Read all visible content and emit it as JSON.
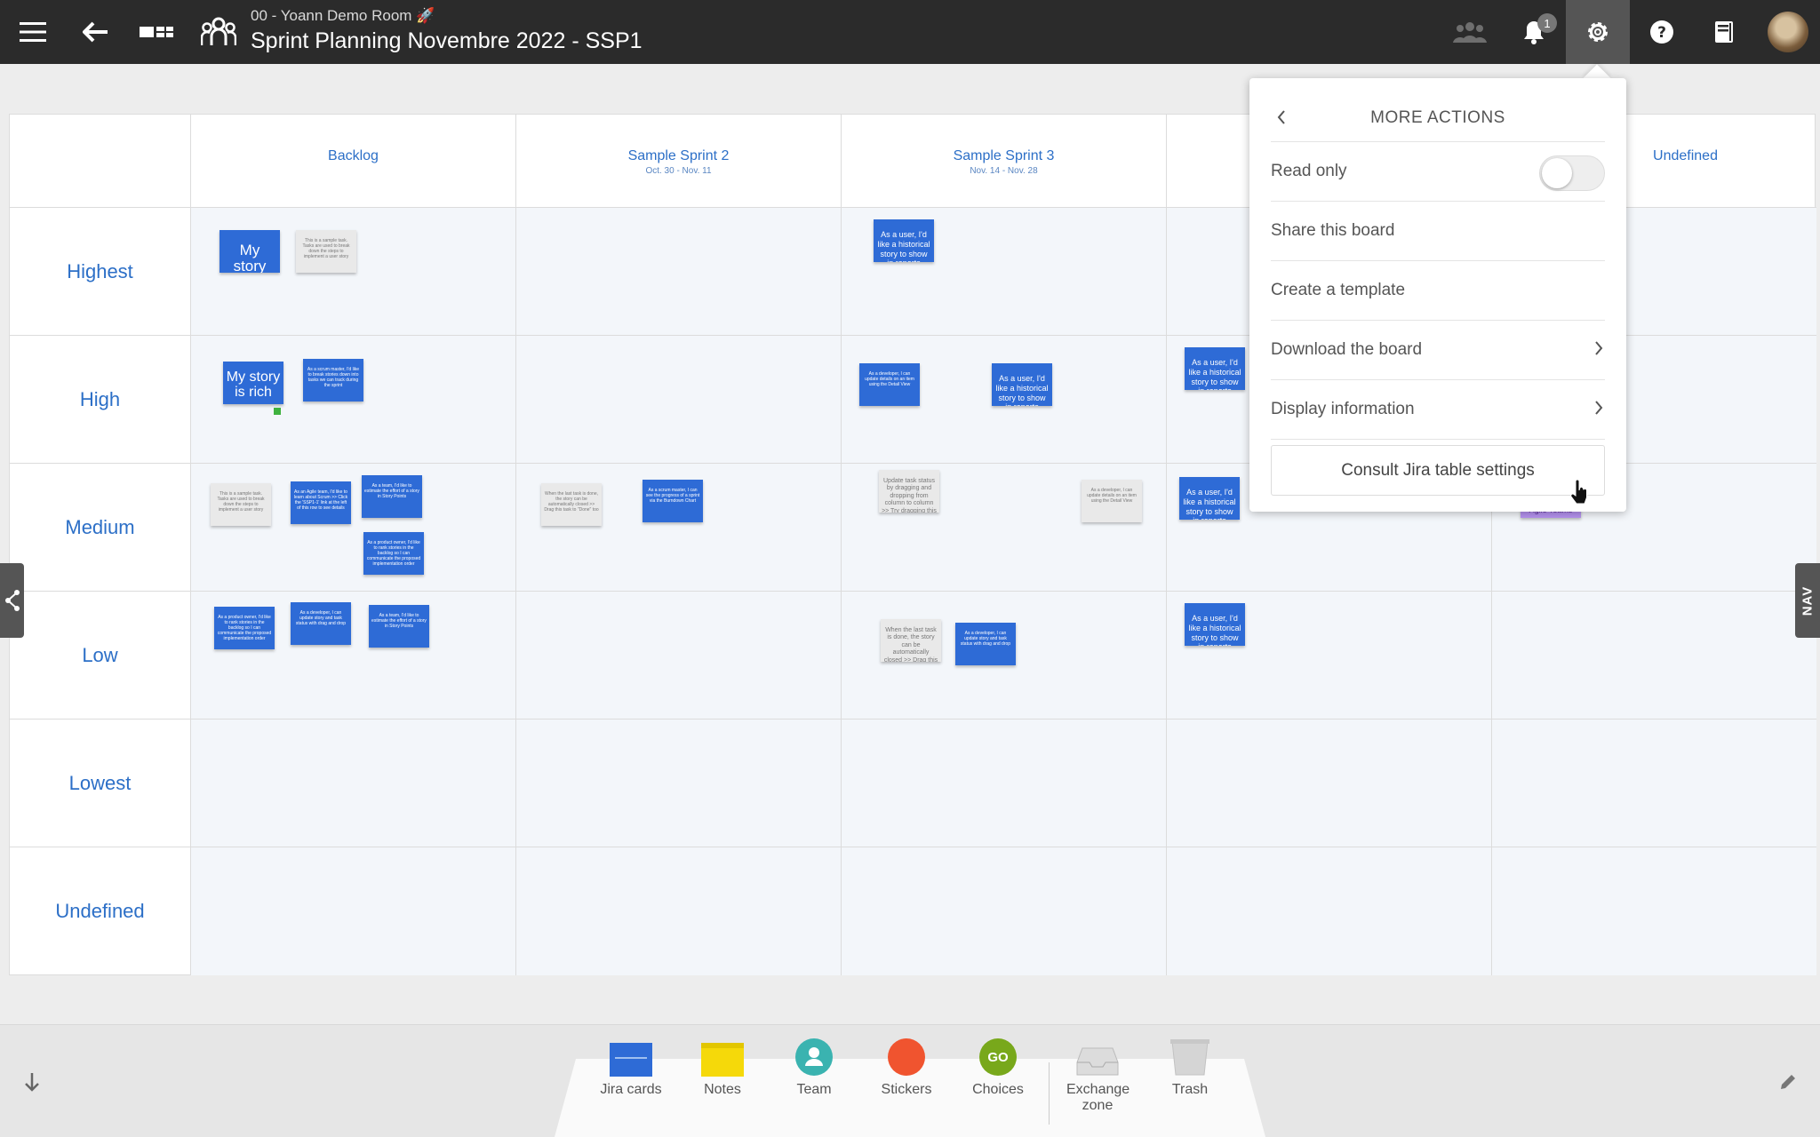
{
  "topbar": {
    "room": "00 - Yoann Demo Room 🚀",
    "title": "Sprint Planning Novembre 2022 - SSP1",
    "notification_count": "1"
  },
  "columns": [
    {
      "name": "Backlog",
      "dates": ""
    },
    {
      "name": "Sample Sprint 2",
      "dates": "Oct. 30 - Nov. 11"
    },
    {
      "name": "Sample Sprint 3",
      "dates": "Nov. 14 - Nov. 28"
    },
    {
      "name": "",
      "dates": ""
    },
    {
      "name": "Undefined",
      "dates": ""
    }
  ],
  "rows": [
    "Highest",
    "High",
    "Medium",
    "Low",
    "Lowest",
    "Undefined"
  ],
  "cards": {
    "my_story": "My story",
    "sample_task": "This is a sample task. Tasks are used to break down the steps to implement a user story",
    "historical": "As a user, I'd like a historical story to show in reports",
    "rich": "My story is rich",
    "scrum_master": "As a scrum master, I'd like to break stories down into tasks we can track during the sprint",
    "team_insight": "As a team, I'd like to estimate the effort of a story in Story Points",
    "agile_team": "As an Agile team, I'd like to learn about Scrum >> Click the 'SSP1-1' link at the left of this row to see details",
    "product_owner": "As a product owner, I'd like to rank stories in the backlog so I can communicate the proposed implementation order",
    "developer_update": "As a developer, I can update story and task status with drag and drop",
    "update_status": "Update task status by dragging and dropping from column to column >> Try dragging this task to \"Done\"",
    "done_closed": "When the last task is done, the story can be automatically closed >> Drag this task to \"Done\" too",
    "dev_details": "As a developer, I can update details on an item using the Detail View",
    "progress": "As a scrum master, I can see the progress of a sprint via the Burndown Chart",
    "purple_label": "Agile Teams"
  },
  "panel": {
    "title": "MORE ACTIONS",
    "read_only": "Read only",
    "share": "Share this board",
    "template": "Create a template",
    "download": "Download the board",
    "display": "Display information",
    "consult": "Consult Jira table settings"
  },
  "side_right_label": "NAV",
  "tools": {
    "jira": "Jira cards",
    "notes": "Notes",
    "team": "Team",
    "stickers": "Stickers",
    "choices": "Choices",
    "choices_badge": "GO",
    "exchange": "Exchange zone",
    "trash": "Trash"
  },
  "colors": {
    "topbar": "#2b2b2b",
    "card_blue": "#2e6bd6",
    "header_text": "#2c6fc7",
    "cell_bg": "#f3f6fa",
    "notes_yellow": "#f5d90a",
    "team_teal": "#3ab3b0",
    "stickers_red": "#f0542f",
    "choices_green": "#78a81b"
  },
  "icons": [
    "menu-icon",
    "back-arrow-icon",
    "board-view-icon",
    "team-icon",
    "group-icon",
    "bell-icon",
    "gear-icon",
    "help-icon",
    "book-icon",
    "scroll-down-icon",
    "pencil-icon"
  ]
}
